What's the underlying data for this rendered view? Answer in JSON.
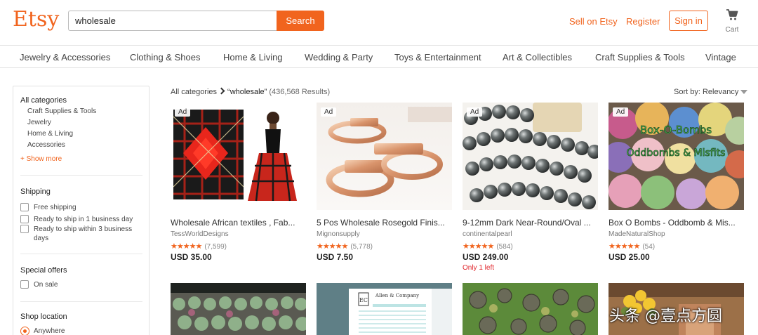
{
  "header": {
    "logo": "Etsy",
    "search": {
      "value": "wholesale",
      "button_label": "Search"
    },
    "sell_label": "Sell on Etsy",
    "register_label": "Register",
    "signin_label": "Sign in",
    "cart_label": "Cart",
    "cart_icon": "cart-icon"
  },
  "categories": [
    "Jewelry & Accessories",
    "Clothing & Shoes",
    "Home & Living",
    "Wedding & Party",
    "Toys & Entertainment",
    "Art & Collectibles",
    "Craft Supplies & Tools",
    "Vintage"
  ],
  "sidebar": {
    "all_categories": "All categories",
    "category_items": [
      "Craft Supplies & Tools",
      "Jewelry",
      "Home & Living",
      "Accessories"
    ],
    "show_more": "+ Show more",
    "shipping": {
      "title": "Shipping",
      "options": [
        "Free shipping",
        "Ready to ship in 1 business day",
        "Ready to ship within 3 business days"
      ]
    },
    "special_offers": {
      "title": "Special offers",
      "options": [
        "On sale"
      ]
    },
    "shop_location": {
      "title": "Shop location",
      "selected": "Anywhere"
    }
  },
  "results": {
    "breadcrumb_root": "All categories",
    "query": "“wholesale”",
    "count": "(436,568 Results)",
    "sort_label": "Sort by: Relevancy"
  },
  "products": [
    {
      "ad": "Ad",
      "title": "Wholesale African textiles , Fab...",
      "shop": "TessWorldDesigns",
      "stars": "★★★★★",
      "rating": 5,
      "reviews": "(7,599)",
      "price": "USD 35.00",
      "stock": ""
    },
    {
      "ad": "Ad",
      "title": "5 Pos Wholesale Rosegold Finis...",
      "shop": "Mignonsupply",
      "stars": "★★★★★",
      "rating": 5,
      "reviews": "(5,778)",
      "price": "USD 7.50",
      "stock": ""
    },
    {
      "ad": "Ad",
      "title": "9-12mm Dark Near-Round/Oval ...",
      "shop": "continentalpearl",
      "stars": "★★★★★",
      "rating": 5,
      "reviews": "(584)",
      "price": "USD 249.00",
      "stock": "Only 1 left"
    },
    {
      "ad": "Ad",
      "title": "Box O Bombs - Oddbomb & Mis...",
      "shop": "MadeNaturalShop",
      "stars": "★★★★★",
      "rating": 5,
      "reviews": "(54)",
      "price": "USD 25.00",
      "stock": "",
      "image_text": [
        "Box-O-Bombs",
        "Oddbombs & Misfits"
      ]
    }
  ],
  "form_image": {
    "heading": "Allen & Company",
    "monogram": "EC"
  },
  "watermark": "头条 @壹点方圆",
  "colors": {
    "accent": "#f1641e",
    "stock_warning": "#e0242a"
  }
}
